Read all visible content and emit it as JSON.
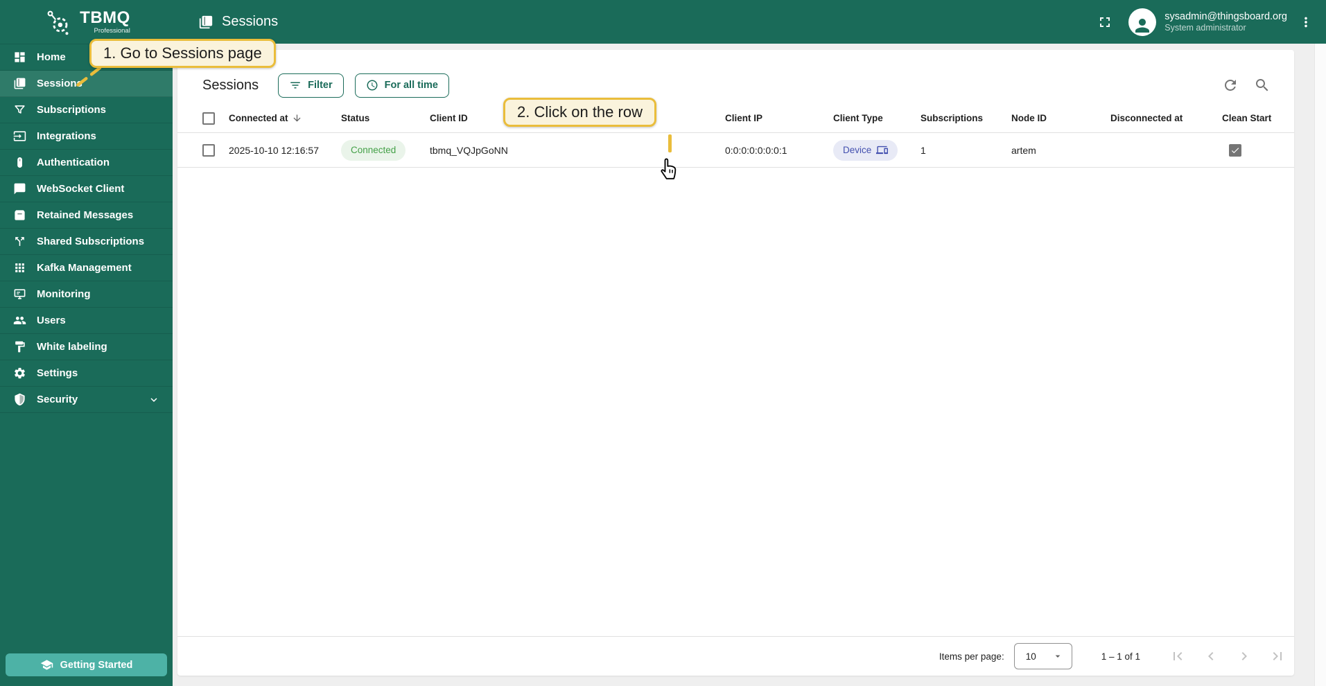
{
  "brand": {
    "name": "TBMQ",
    "edition": "Professional"
  },
  "topbar": {
    "title": "Sessions",
    "user_email": "sysadmin@thingsboard.org",
    "user_role": "System administrator"
  },
  "sidebar": {
    "items": [
      {
        "label": "Home",
        "icon": "dashboard-icon",
        "selected": false
      },
      {
        "label": "Sessions",
        "icon": "sessions-book-icon",
        "selected": true
      },
      {
        "label": "Subscriptions",
        "icon": "funnel-icon",
        "selected": false
      },
      {
        "label": "Integrations",
        "icon": "input-icon",
        "selected": false
      },
      {
        "label": "Authentication",
        "icon": "mouse-icon",
        "selected": false
      },
      {
        "label": "WebSocket Client",
        "icon": "chat-icon",
        "selected": false
      },
      {
        "label": "Retained Messages",
        "icon": "archive-icon",
        "selected": false
      },
      {
        "label": "Shared Subscriptions",
        "icon": "call-split-icon",
        "selected": false
      },
      {
        "label": "Kafka Management",
        "icon": "apps-grid-icon",
        "selected": false
      },
      {
        "label": "Monitoring",
        "icon": "monitor-icon",
        "selected": false
      },
      {
        "label": "Users",
        "icon": "users-icon",
        "selected": false
      },
      {
        "label": "White labeling",
        "icon": "paint-roller-icon",
        "selected": false
      },
      {
        "label": "Settings",
        "icon": "gear-icon",
        "selected": false
      },
      {
        "label": "Security",
        "icon": "shield-icon",
        "selected": false,
        "expandable": true
      }
    ],
    "getting_started": "Getting Started"
  },
  "page": {
    "title": "Sessions",
    "filter_label": "Filter",
    "time_label": "For all time"
  },
  "table": {
    "columns": [
      {
        "label": "Connected at",
        "sorted": "desc"
      },
      {
        "label": "Status"
      },
      {
        "label": "Client ID"
      },
      {
        "label": "Client IP"
      },
      {
        "label": "Client Type"
      },
      {
        "label": "Subscriptions"
      },
      {
        "label": "Node ID"
      },
      {
        "label": "Disconnected at"
      },
      {
        "label": "Clean Start"
      }
    ],
    "sort_arrow": "↓",
    "rows": [
      {
        "connected_at": "2025-10-10 12:16:57",
        "status": "Connected",
        "client_id": "tbmq_VQJpGoNN",
        "client_ip": "0:0:0:0:0:0:0:1",
        "client_type": "Device",
        "subscriptions": "1",
        "node_id": "artem",
        "disconnected_at": "",
        "clean_start": true
      }
    ]
  },
  "pagination": {
    "items_per_page_label": "Items per page:",
    "page_size": "10",
    "range_label": "1 – 1 of 1"
  },
  "annotations": {
    "step1": "1. Go to Sessions page",
    "step2": "2. Click on the row"
  },
  "colors": {
    "brand_green": "#1a6b59",
    "selected_item_green": "#2f7b69",
    "getting_started_teal": "#4db2a6",
    "callout_border": "#eabd3b",
    "callout_bg": "#faf3dc",
    "status_connected_bg": "#eaf4ea",
    "status_connected_text": "#43a047",
    "client_type_bg": "#e8eaf6",
    "client_type_text": "#4350af"
  },
  "icons": [
    "logo-gear-icon",
    "sessions-book-icon",
    "fullscreen-icon",
    "avatar-person-icon",
    "kebab-menu-icon",
    "filter-list-icon",
    "clock-icon",
    "refresh-icon",
    "search-icon",
    "arrow-down-icon",
    "device-icon",
    "first-page-icon",
    "chevron-left-icon",
    "chevron-right-icon",
    "last-page-icon",
    "chevron-down-icon",
    "graduation-cap-icon",
    "pointer-cursor-icon"
  ]
}
